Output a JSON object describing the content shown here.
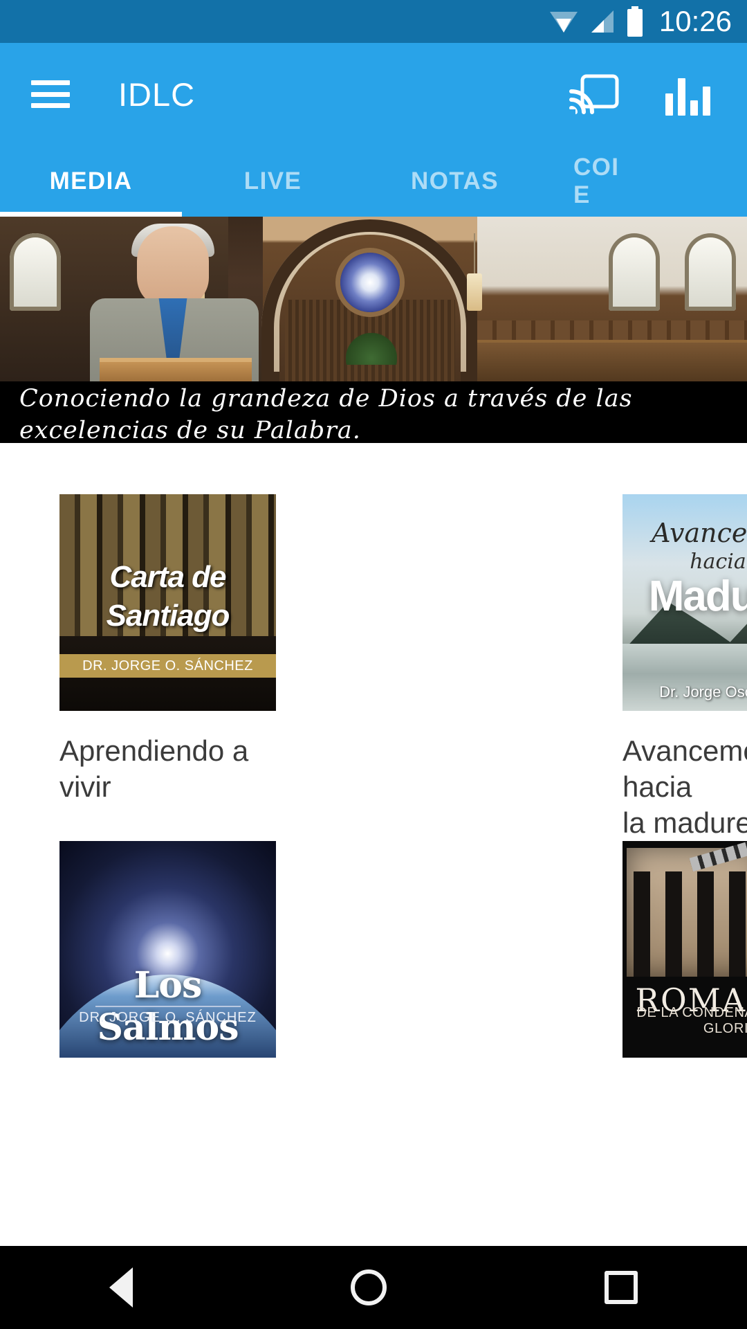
{
  "status_bar": {
    "time": "10:26",
    "icons": [
      "wifi-icon",
      "signal-icon",
      "battery-icon"
    ],
    "background": "#1271a8"
  },
  "app_bar": {
    "title": "IDLC",
    "menu_icon": "hamburger-menu-icon",
    "cast_icon": "cast-icon",
    "equalizer_icon": "equalizer-icon",
    "background": "#29a3e8"
  },
  "tabs": {
    "active_index": 0,
    "items": [
      {
        "label": "MEDIA",
        "active": true
      },
      {
        "label": "LIVE",
        "active": false
      },
      {
        "label": "NOTAS",
        "active": false
      },
      {
        "label": "COI\nE",
        "active": false
      }
    ]
  },
  "hero": {
    "image_description": "church-sanctuary-preacher-banner",
    "caption_line1": "Conociendo la grandeza de Dios a través  de las",
    "caption_line2": "excelencias de su Palabra."
  },
  "media_grid": {
    "cards": [
      {
        "title": "Aprendiendo a\nvivir",
        "thumb_name": "carta-de-santiago-thumbnail",
        "thumb_title": "Carta de\nSantiago",
        "thumb_author": "DR. JORGE O. SÁNCHEZ",
        "accent": "#b99a4e"
      },
      {
        "title": "Avancemos hacia\nla madurez",
        "thumb_name": "avancemos-hacia-la-madurez-thumbnail",
        "thumb_line1": "Avancemos,",
        "thumb_line2": "hacia la",
        "thumb_line3": "Madurez",
        "thumb_author": "Dr. Jorge Oscar Sánchez"
      },
      {
        "title": "",
        "thumb_name": "los-salmos-thumbnail",
        "thumb_title": "Los Salmos",
        "thumb_author": "DR. JORGE O. SÁNCHEZ"
      },
      {
        "title": "",
        "thumb_name": "romanos-thumbnail",
        "thumb_title": "ROMANOS",
        "thumb_subtitle": "DE LA CONDENACIÓN A LA GLORIA"
      }
    ]
  },
  "nav_bar": {
    "back_icon": "back-triangle-icon",
    "home_icon": "home-circle-icon",
    "recents_icon": "recents-square-icon",
    "background": "#000000"
  }
}
